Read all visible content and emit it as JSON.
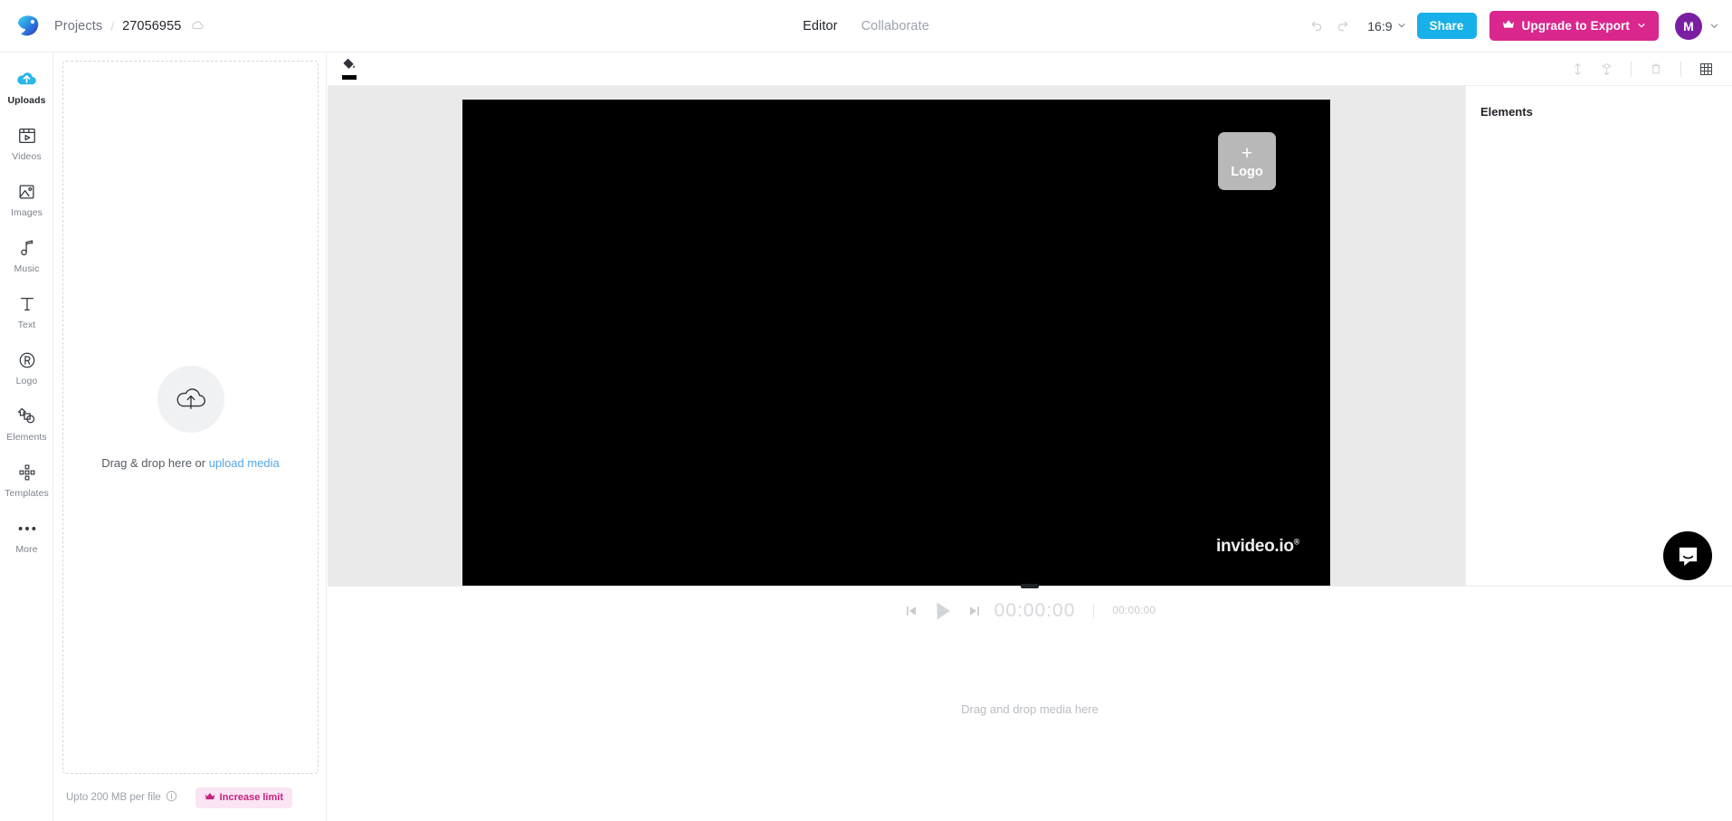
{
  "app": {
    "brand_icon": "invideo-bird-logo",
    "accent_blue": "#17b0e8",
    "accent_pink": "#d9278e",
    "avatar_purple": "#7b1fa2"
  },
  "topbar": {
    "breadcrumb": {
      "projects_label": "Projects",
      "separator": "/",
      "project_name": "27056955",
      "cloud_icon": "cloud-sync-icon"
    },
    "tabs": [
      {
        "label": "Editor",
        "active": true
      },
      {
        "label": "Collaborate",
        "active": false
      }
    ],
    "undo_icon": "undo-icon",
    "redo_icon": "redo-icon",
    "aspect_ratio": "16:9",
    "aspect_caret": "chevron-down-icon",
    "share_label": "Share",
    "upgrade_label": "Upgrade to Export",
    "upgrade_crown_icon": "crown-icon",
    "upgrade_caret": "chevron-down-icon",
    "avatar_initial": "M",
    "avatar_caret": "chevron-down-icon"
  },
  "sidebar": {
    "items": [
      {
        "label": "Uploads",
        "icon": "cloud-upload-icon",
        "active": true
      },
      {
        "label": "Videos",
        "icon": "video-clip-icon",
        "active": false
      },
      {
        "label": "Images",
        "icon": "image-icon",
        "active": false
      },
      {
        "label": "Music",
        "icon": "music-note-icon",
        "active": false
      },
      {
        "label": "Text",
        "icon": "text-t-icon",
        "active": false
      },
      {
        "label": "Logo",
        "icon": "registered-r-icon",
        "active": false
      },
      {
        "label": "Elements",
        "icon": "shapes-icon",
        "active": false
      },
      {
        "label": "Templates",
        "icon": "templates-grid-icon",
        "active": false
      },
      {
        "label": "More",
        "icon": "ellipsis-icon",
        "active": false
      }
    ]
  },
  "uploads_panel": {
    "dropzone_icon": "cloud-upload-outline-icon",
    "drop_text_prefix": "Drag & drop here or ",
    "drop_link_label": "upload media",
    "footer_note": "Upto 200 MB per file",
    "footer_info_icon": "info-circle-icon",
    "increase_limit_label": "Increase limit",
    "increase_limit_icon": "crown-icon"
  },
  "canvas_toolbar": {
    "fill_tool_icon": "paint-bucket-icon",
    "fill_color": "#000000",
    "right_icons": [
      {
        "name": "bring-forward-icon"
      },
      {
        "name": "send-backward-icon"
      },
      {
        "name": "delete-icon"
      },
      {
        "name": "grid-layout-icon"
      }
    ]
  },
  "stage": {
    "background_color": "#eaeaea",
    "video_background": "#000000",
    "logo_placeholder": {
      "plus": "+",
      "label": "Logo"
    },
    "watermark": "invideo.io",
    "watermark_superscript": "®"
  },
  "right_panel": {
    "title": "Elements"
  },
  "player": {
    "prev_icon": "skip-previous-icon",
    "play_icon": "play-icon",
    "next_icon": "skip-next-icon",
    "current_time": "00:00:00",
    "total_time": "00:00:00"
  },
  "timeline": {
    "empty_hint": "Drag and drop media here"
  },
  "chat": {
    "icon": "intercom-chat-icon"
  }
}
